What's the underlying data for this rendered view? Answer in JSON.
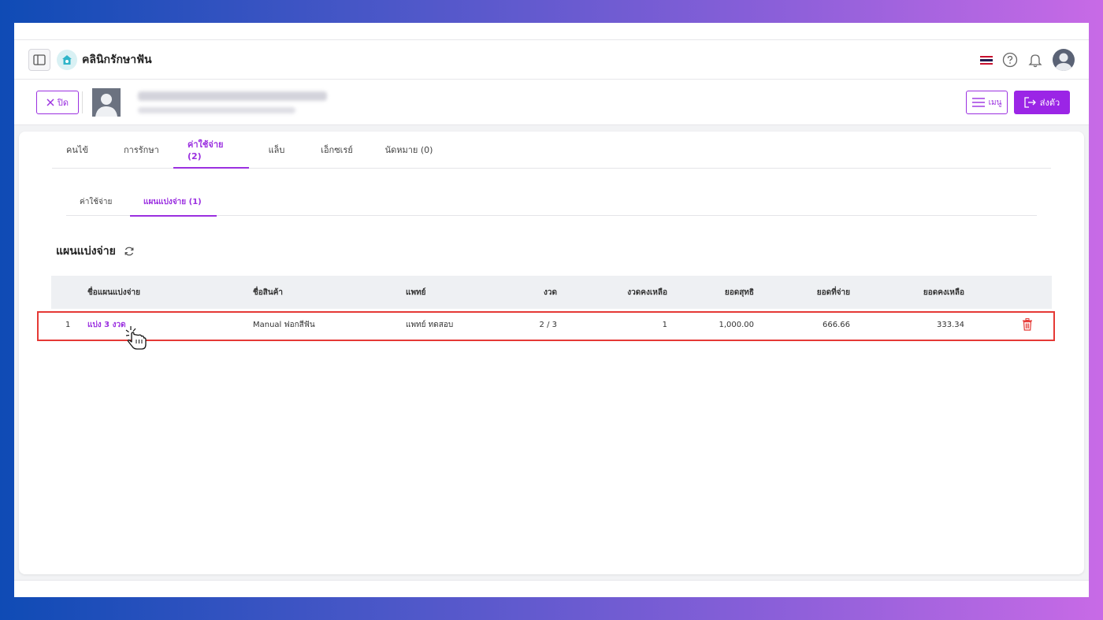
{
  "header": {
    "app_title": "คลินิกรักษาฟัน"
  },
  "patient_bar": {
    "close_label": "ปิด",
    "menu_label": "เมนู",
    "send_label": "ส่งตัว"
  },
  "tabs": [
    {
      "label": "คนไข้"
    },
    {
      "label": "การรักษา"
    },
    {
      "label": "ค่าใช้จ่าย (2)"
    },
    {
      "label": "แล็บ"
    },
    {
      "label": "เอ็กซเรย์"
    },
    {
      "label": "นัดหมาย (0)"
    }
  ],
  "subtabs": [
    {
      "label": "ค่าใช้จ่าย"
    },
    {
      "label": "แผนแบ่งจ่าย (1)"
    }
  ],
  "section": {
    "title": "แผนแบ่งจ่าย"
  },
  "table": {
    "headers": {
      "plan_name": "ชื่อแผนแบ่งจ่าย",
      "product": "ชื่อสินค้า",
      "doctor": "แพทย์",
      "installment": "งวด",
      "remaining_installments": "งวดคงเหลือ",
      "net_total": "ยอดสุทธิ",
      "paid": "ยอดที่จ่าย",
      "balance": "ยอดคงเหลือ"
    },
    "rows": [
      {
        "no": "1",
        "plan_name": "แบ่ง 3 งวด",
        "product": "Manual ฟอกสีฟัน",
        "doctor": "แพทย์ ทดสอบ",
        "installment": "2 / 3",
        "remaining_installments": "1",
        "net_total": "1,000.00",
        "paid": "666.66",
        "balance": "333.34"
      }
    ]
  },
  "colors": {
    "accent": "#9b30e0",
    "highlight": "#e53935",
    "delete": "#e53935"
  }
}
